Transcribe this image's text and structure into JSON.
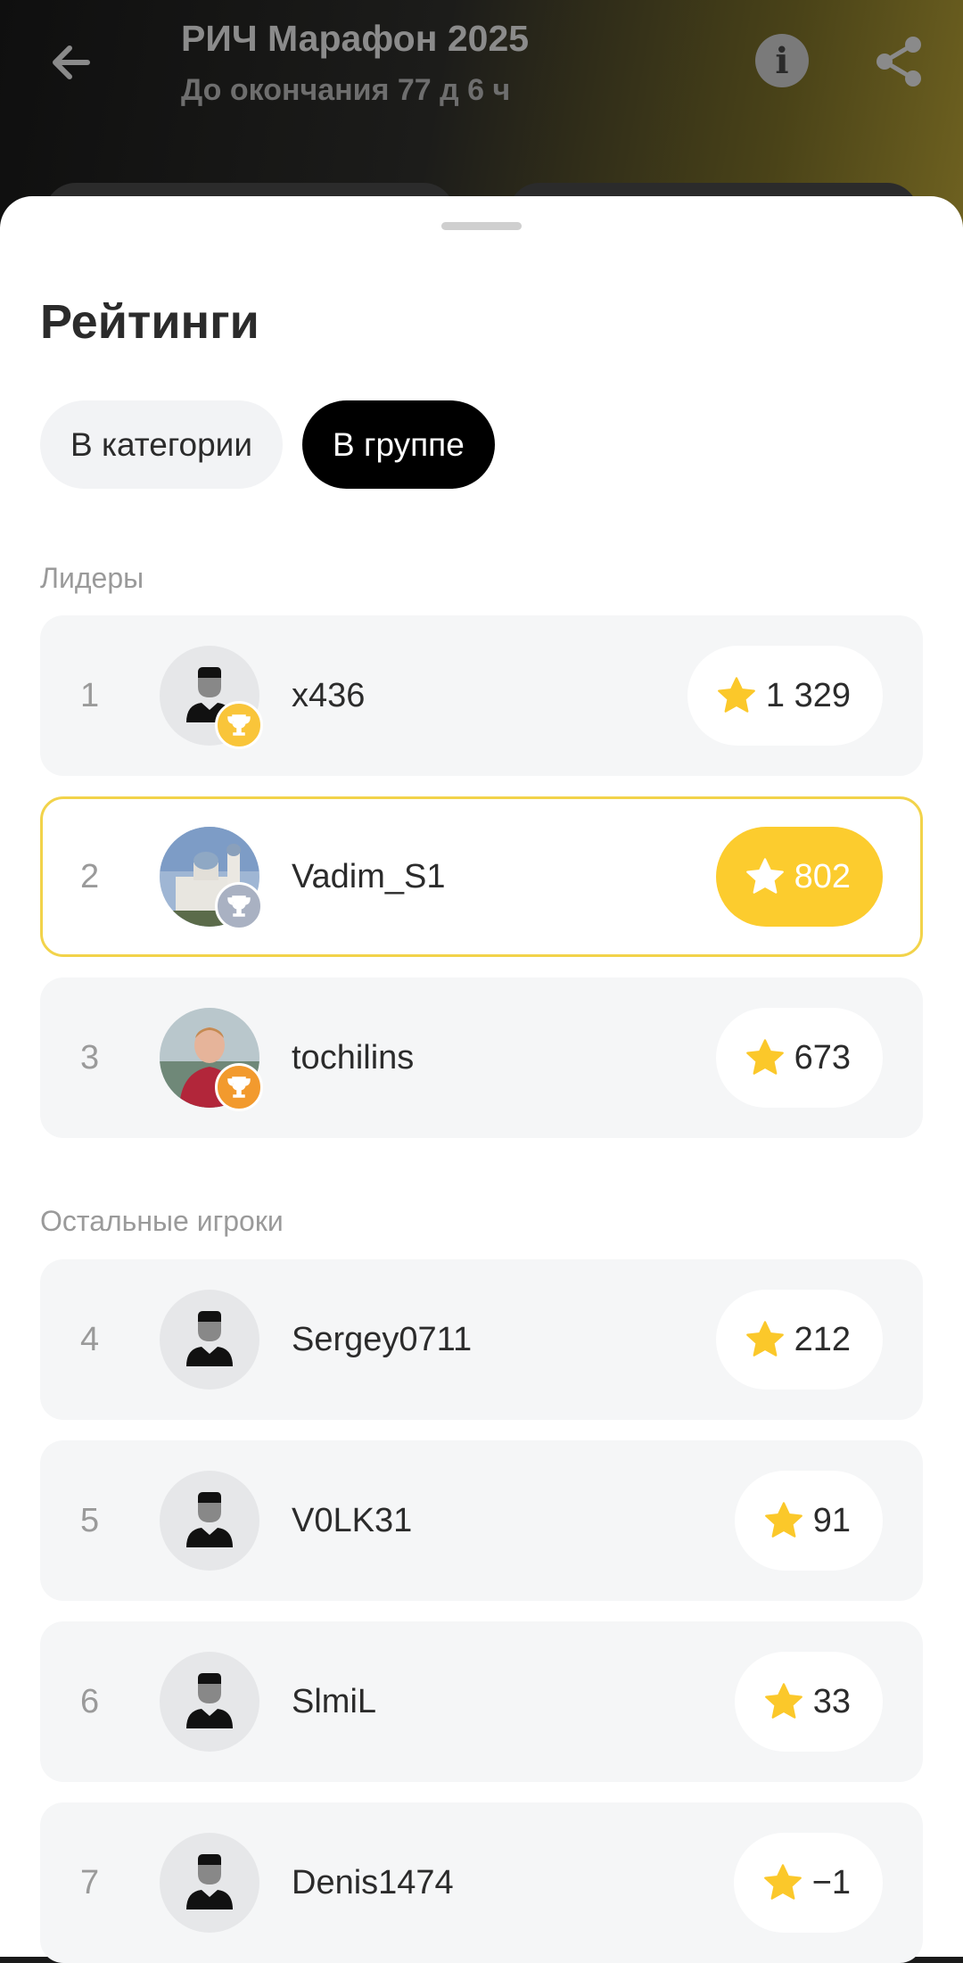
{
  "header": {
    "title": "РИЧ Марафон 2025",
    "subtitle": "До окончания 77 д 6 ч"
  },
  "sheet": {
    "title": "Рейтинги",
    "tabs": [
      {
        "label": "В категории",
        "active": false
      },
      {
        "label": "В группе",
        "active": true
      }
    ],
    "leaders_label": "Лидеры",
    "others_label": "Остальные игроки"
  },
  "leaders": [
    {
      "rank": "1",
      "name": "x436",
      "score": "1 329",
      "trophy": "gold",
      "avatar": "default"
    },
    {
      "rank": "2",
      "name": "Vadim_S1",
      "score": "802",
      "trophy": "silver",
      "avatar": "photo-church",
      "current_user": true
    },
    {
      "rank": "3",
      "name": "tochilins",
      "score": "673",
      "trophy": "bronze",
      "avatar": "photo-person"
    }
  ],
  "others": [
    {
      "rank": "4",
      "name": "Sergey0711",
      "score": "212",
      "avatar": "default"
    },
    {
      "rank": "5",
      "name": "V0LK31",
      "score": "91",
      "avatar": "default"
    },
    {
      "rank": "6",
      "name": "SlmiL",
      "score": "33",
      "avatar": "default"
    },
    {
      "rank": "7",
      "name": "Denis1474",
      "score": "−1",
      "avatar": "default"
    }
  ],
  "colors": {
    "accent_yellow": "#fccc2e",
    "star": "#fbc82a",
    "trophy_gold": "#f9c53a",
    "trophy_silver": "#a9b1c2",
    "trophy_bronze": "#f29a2e",
    "highlight_border": "#f2d34a"
  },
  "icons": [
    "back-arrow-icon",
    "info-icon",
    "share-icon",
    "star-icon",
    "trophy-icon",
    "default-avatar-icon"
  ]
}
